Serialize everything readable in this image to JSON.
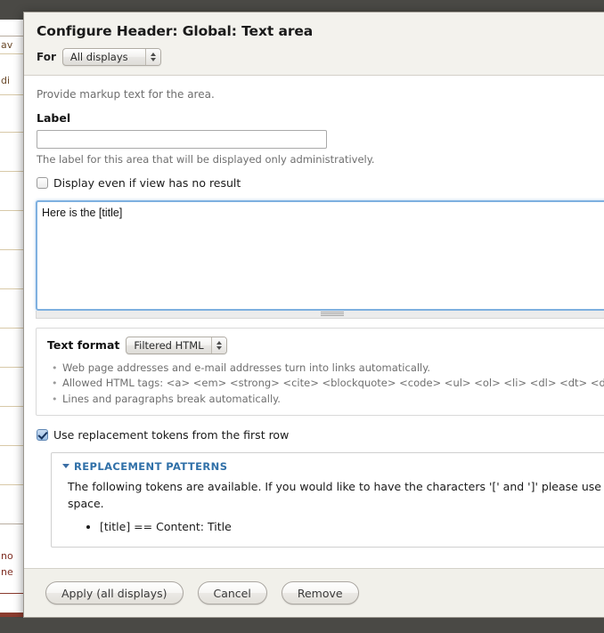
{
  "background_page": {
    "fragments": [
      "av",
      "di",
      "no",
      "ne"
    ]
  },
  "modal": {
    "title": "Configure Header: Global: Text area",
    "for": {
      "label": "For",
      "selected": "All displays",
      "options": [
        "All displays"
      ]
    },
    "description": "Provide markup text for the area.",
    "label_field": {
      "label": "Label",
      "value": "",
      "placeholder": "",
      "help": "The label for this area that will be displayed only administratively."
    },
    "display_even_checkbox": {
      "label": "Display even if view has no result",
      "checked": false
    },
    "body_textarea": {
      "value": "Here is the [title]",
      "placeholder": ""
    },
    "text_format": {
      "label": "Text format",
      "selected": "Filtered HTML",
      "options": [
        "Filtered HTML"
      ],
      "tips": [
        "Web page addresses and e-mail addresses turn into links automatically.",
        "Allowed HTML tags: <a> <em> <strong> <cite> <blockquote> <code> <ul> <ol> <li> <dl> <dt> <dd>",
        "Lines and paragraphs break automatically."
      ]
    },
    "tokens_checkbox": {
      "label": "Use replacement tokens from the first row",
      "checked": true
    },
    "replacement_patterns": {
      "legend": "REPLACEMENT PATTERNS",
      "description_line1": "The following tokens are available. If you would like to have the characters '[' and ']' please use the",
      "description_line2": "space.",
      "tokens": [
        "[title] == Content: Title"
      ]
    },
    "footer": {
      "apply_label": "Apply (all displays)",
      "cancel_label": "Cancel",
      "remove_label": "Remove"
    }
  },
  "colors": {
    "backdrop": "#4a4945",
    "header_bg": "#f3f2ed",
    "focus_border": "#7eb0e0",
    "link_blue": "#3070a8",
    "checked_blue": "#16325c"
  }
}
